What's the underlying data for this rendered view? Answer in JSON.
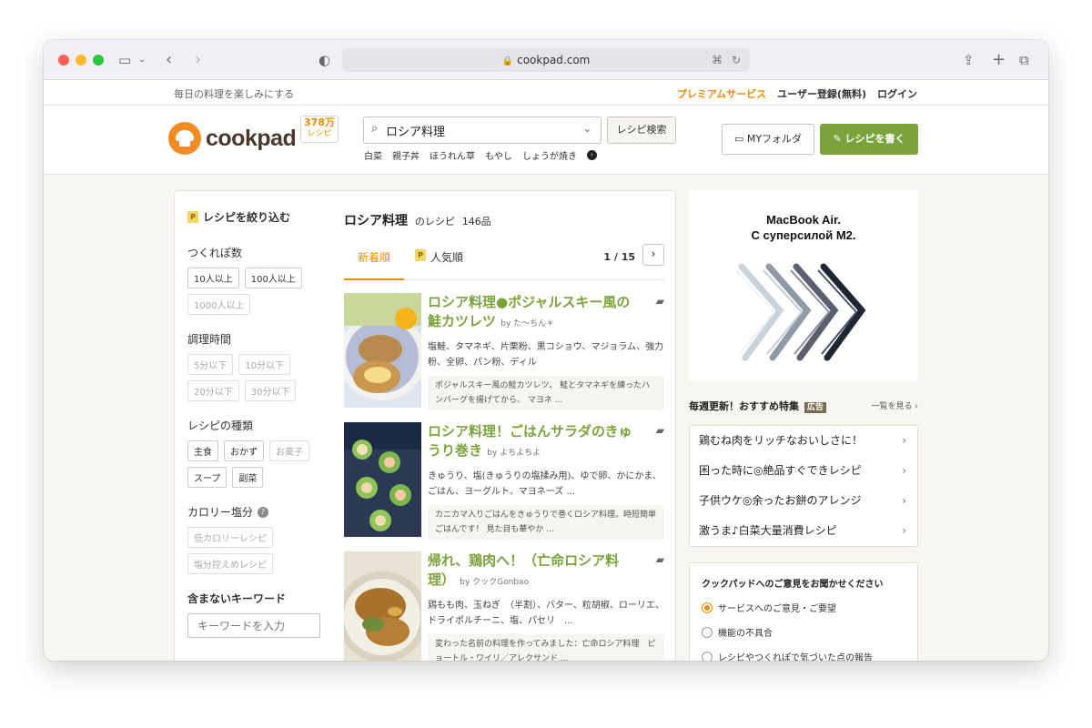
{
  "browser": {
    "url": "cookpad.com"
  },
  "topbar": {
    "tagline": "毎日の料理を楽しみにする",
    "premium": "プレミアムサービス",
    "register": "ユーザー登録(無料)",
    "login": "ログイン"
  },
  "header": {
    "logo": "cookpad",
    "count_num": "378万",
    "count_unit": "レシピ",
    "search_value": "ロシア料理",
    "search_button": "レシピ検索",
    "keywords": [
      "白菜",
      "親子丼",
      "ほうれん草",
      "もやし",
      "しょうが焼き"
    ],
    "my_folder": "MYフォルダ",
    "write_recipe": "レシピを書く"
  },
  "filter": {
    "title": "レシピを絞り込む",
    "sections": [
      {
        "label": "つくれぽ数",
        "chips": [
          "10人以上",
          "100人以上",
          "1000人以上"
        ]
      },
      {
        "label": "調理時間",
        "chips": [
          "5分以下",
          "10分以下",
          "20分以下",
          "30分以下"
        ]
      },
      {
        "label": "レシピの種類",
        "chips": [
          "主食",
          "おかず",
          "お菓子",
          "スープ",
          "副菜"
        ]
      },
      {
        "label": "カロリー塩分",
        "chips": [
          "低カロリーレシピ",
          "塩分控えめレシピ"
        ]
      }
    ],
    "exclude_label": "含まないキーワード",
    "exclude_placeholder": "キーワードを入力"
  },
  "results": {
    "keyword": "ロシア料理",
    "suffix": "のレシピ",
    "count": "146品",
    "tab_new": "新着順",
    "tab_popular": "人気順",
    "page": "1 / 15",
    "recipes": [
      {
        "title": "ロシア料理●ポジャルスキー風の鮭カツレツ",
        "author": "by た〜ちん＊",
        "ingredients": "塩鮭、タマネギ、片栗粉、黒コショウ、マジョラム、強力粉、全卵、パン粉、ディル",
        "description": "ポジャルスキー風の鮭カツレツ。 鮭とタマネギを練ったハンバーグを揚げてから、 マヨネ ..."
      },
      {
        "title": "ロシア料理！ごはんサラダのきゅうり巻き",
        "author": "by よちよちよ",
        "ingredients": "きゅうり、塩(きゅうりの塩揉み用)、ゆで卵、かにかま、ごはん、ヨーグルト、マヨネーズ ...",
        "description": "カニカマ入りごはんをきゅうりで巻くロシア料理。時短簡単ごはんです！ 見た目も華やか ..."
      },
      {
        "title": "帰れ、鶏肉へ！（亡命ロシア料理）",
        "author": "by クックGonbao",
        "ingredients": "鶏もも肉、玉ねぎ　（半割）、バター、粒胡椒、ローリエ、ドライポルチーニ、塩、パセリ　...",
        "description": "変わった名前の料理を作ってみました：亡命ロシア料理　ピョートル・ワイリ／アレクサンド ..."
      }
    ]
  },
  "ad": {
    "line1": "MacBook Air.",
    "line2": "С суперсилой M2."
  },
  "features": {
    "title": "毎週更新！おすすめ特集",
    "ad_tag": "広告",
    "see_all": "一覧を見る",
    "items": [
      "鶏むね肉をリッチなおいしさに！",
      "困った時に◎絶品すぐできレシピ",
      "子供ウケ◎余ったお餅のアレンジ",
      "激うま♪白菜大量消費レシピ"
    ]
  },
  "survey": {
    "title": "クックパッドへのご意見をお聞かせください",
    "options": [
      "サービスへのご意見・ご要望",
      "機能の不具合",
      "レシピやつくれぽで気づいた点の報告"
    ]
  },
  "colors": {
    "accent_orange": "#f08c00",
    "recipe_green": "#7ba33b"
  }
}
